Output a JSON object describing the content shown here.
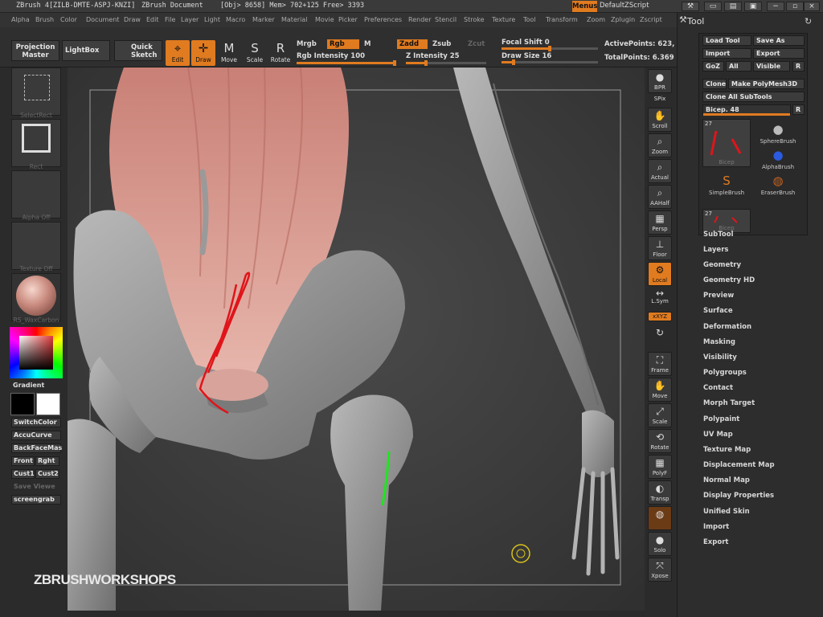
{
  "titlebar": {
    "app": "ZBrush 4[ZILB-DMTE-ASPJ-KNZI]",
    "doc": "ZBrush Document",
    "stats": "[Obj> 8658] Mem> 702+125 Free> 3393",
    "menus": "Menus",
    "script": "DefaultZScript"
  },
  "menubar": [
    "Alpha",
    "Brush",
    "Color",
    "Document",
    "Draw",
    "Edit",
    "File",
    "Layer",
    "Light",
    "Macro",
    "Marker",
    "Material",
    "Movie",
    "Picker",
    "Preferences",
    "Render",
    "Stencil",
    "Stroke",
    "Texture",
    "Tool",
    "Transform",
    "Zoom",
    "Zplugin",
    "Zscript"
  ],
  "toolbar": {
    "projection_master": "Projection Master",
    "lightbox": "LightBox",
    "quick_sketch": "Quick Sketch",
    "edit": "Edit",
    "draw": "Draw",
    "move": "Move",
    "scale": "Scale",
    "rotate": "Rotate",
    "mrgb": "Mrgb",
    "rgb": "Rgb",
    "m": "M",
    "zadd": "Zadd",
    "zsub": "Zsub",
    "zcut": "Zcut",
    "rgb_intensity_label": "Rgb Intensity 100",
    "rgb_intensity": 100,
    "z_intensity_label": "Z Intensity 25",
    "z_intensity": 25,
    "focal_shift_label": "Focal Shift 0",
    "focal_shift": 0,
    "draw_size_label": "Draw Size 16",
    "draw_size": 16,
    "active_points": "ActivePoints: 623,",
    "total_points": "TotalPoints: 6.369"
  },
  "leftshelf": {
    "select_rect": "SelectRect",
    "rect": "Rect",
    "alpha_off": "Alpha Off",
    "texture_off": "Texture Off",
    "material": "RS_WaxCarbon",
    "gradient": "Gradient",
    "switch_color": "SwitchColor",
    "accu_curve": "AccuCurve",
    "backface_mask": "BackFaceMas",
    "front": "Front",
    "right": "Rght",
    "cust1": "Cust1",
    "cust2": "Cust2",
    "save_view": "Save Viewe",
    "screengrab": "screengrab"
  },
  "canvas": {
    "watermark": "ZBRUSHWORKSHOPS"
  },
  "rightshelf": [
    "BPR",
    "SPix",
    "Scroll",
    "Zoom",
    "Actual",
    "AAHalf",
    "Persp",
    "Floor",
    "Local",
    "L.Sym",
    "xXYZ",
    "Frame",
    "Move",
    "Scale",
    "Rotate",
    "PolyF",
    "Transp",
    "Ghost",
    "Solo",
    "Xpose"
  ],
  "toolpanel": {
    "title": "Tool",
    "load_tool": "Load Tool",
    "save_as": "Save As",
    "import": "Import",
    "export": "Export",
    "goz": "GoZ",
    "all": "All",
    "visible": "Visible",
    "r": "R",
    "clone": "Clone",
    "make_polymesh": "Make PolyMesh3D",
    "clone_all": "Clone All SubTools",
    "current_tool_label": "Bicep. 48",
    "current_tool_value": 48,
    "thumb_count_1": "27",
    "thumb_cap_1": "Bicep",
    "thumb_count_2": "27",
    "thumb_cap_2": "Bicep",
    "brushes": [
      "SphereBrush",
      "AlphaBrush",
      "SimpleBrush",
      "EraserBrush"
    ],
    "sections": [
      "SubTool",
      "Layers",
      "Geometry",
      "Geometry HD",
      "Preview",
      "Surface",
      "Deformation",
      "Masking",
      "Visibility",
      "Polygroups",
      "Contact",
      "Morph Target",
      "Polypaint",
      "UV Map",
      "Texture Map",
      "Displacement Map",
      "Normal Map",
      "Display Properties",
      "Unified Skin",
      "Import",
      "Export"
    ]
  },
  "colors": {
    "accent": "#e07b20",
    "stroke_red": "#e0141a",
    "stroke_green": "#1ee61e"
  }
}
